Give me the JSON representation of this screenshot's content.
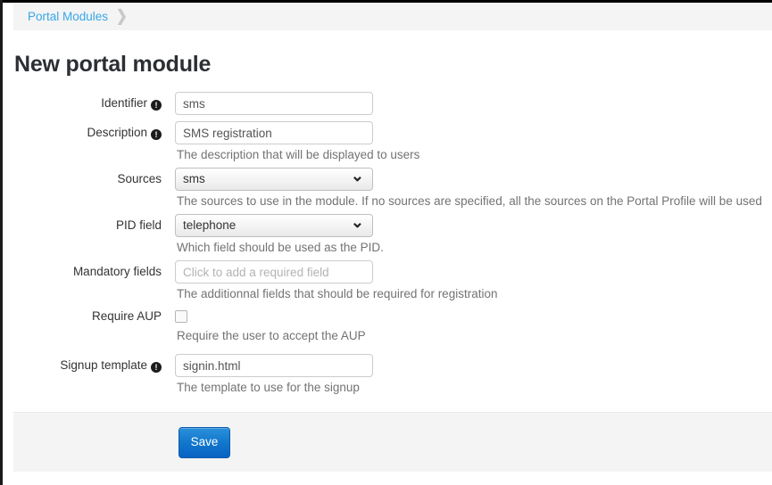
{
  "breadcrumb": {
    "link_label": "Portal Modules",
    "separator_icon": "chevron-right-icon",
    "separator_glyph": "❯"
  },
  "page": {
    "title": "New portal module"
  },
  "colors": {
    "link": "#36a7e8",
    "primary_button": "#1278cd",
    "help_text": "#737373",
    "panel_background": "#f4f4f4"
  },
  "form": {
    "rows": [
      {
        "label": "Identifier",
        "has_info_icon": true,
        "info_glyph": "!",
        "type": "text",
        "value": "sms",
        "placeholder": "",
        "help": ""
      },
      {
        "label": "Description",
        "has_info_icon": true,
        "info_glyph": "!",
        "type": "text",
        "value": "SMS registration",
        "placeholder": "",
        "help": "The description that will be displayed to users"
      },
      {
        "label": "Sources",
        "has_info_icon": false,
        "info_glyph": "",
        "type": "select",
        "value": "sms",
        "placeholder": "",
        "help": "The sources to use in the module. If no sources are specified, all the sources on the Portal Profile will be used"
      },
      {
        "label": "PID field",
        "has_info_icon": false,
        "info_glyph": "",
        "type": "select",
        "value": "telephone",
        "placeholder": "",
        "help": "Which field should be used as the PID."
      },
      {
        "label": "Mandatory fields",
        "has_info_icon": false,
        "info_glyph": "",
        "type": "text",
        "value": "",
        "placeholder": "Click to add a required field",
        "help": "The additionnal fields that should be required for registration"
      },
      {
        "label": "Require AUP",
        "has_info_icon": false,
        "info_glyph": "",
        "type": "checkbox",
        "value": "",
        "checked": false,
        "placeholder": "",
        "help": "Require the user to accept the AUP"
      },
      {
        "label": "Signup template",
        "has_info_icon": true,
        "info_glyph": "!",
        "type": "text",
        "value": "signin.html",
        "placeholder": "",
        "help": "The template to use for the signup"
      }
    ]
  },
  "actions": {
    "save_label": "Save"
  }
}
